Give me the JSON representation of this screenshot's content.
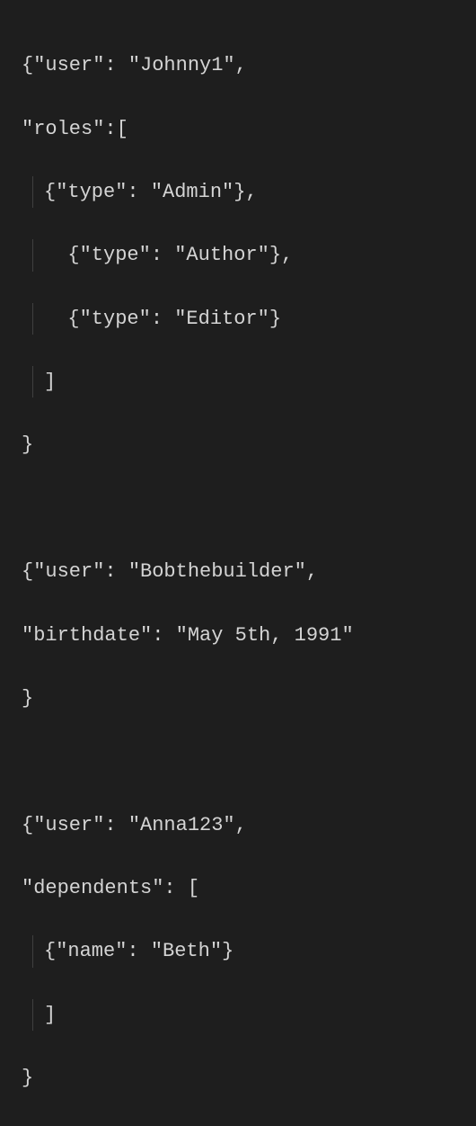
{
  "code": {
    "l1": "{\"user\": \"Johnny1\",",
    "l2": "\"roles\":[",
    "l3": "{\"type\": \"Admin\"},",
    "l4": "  {\"type\": \"Author\"},",
    "l5": "  {\"type\": \"Editor\"}",
    "l6": "]",
    "l7": "}",
    "l8": "",
    "l9": "{\"user\": \"Bobthebuilder\",",
    "l10": "\"birthdate\": \"May 5th, 1991\"",
    "l11": "}",
    "l12": "",
    "l13": "{\"user\": \"Anna123\",",
    "l14": "\"dependents\": [",
    "l15": "{\"name\": \"Beth\"}",
    "l16": "]",
    "l17": "}"
  }
}
